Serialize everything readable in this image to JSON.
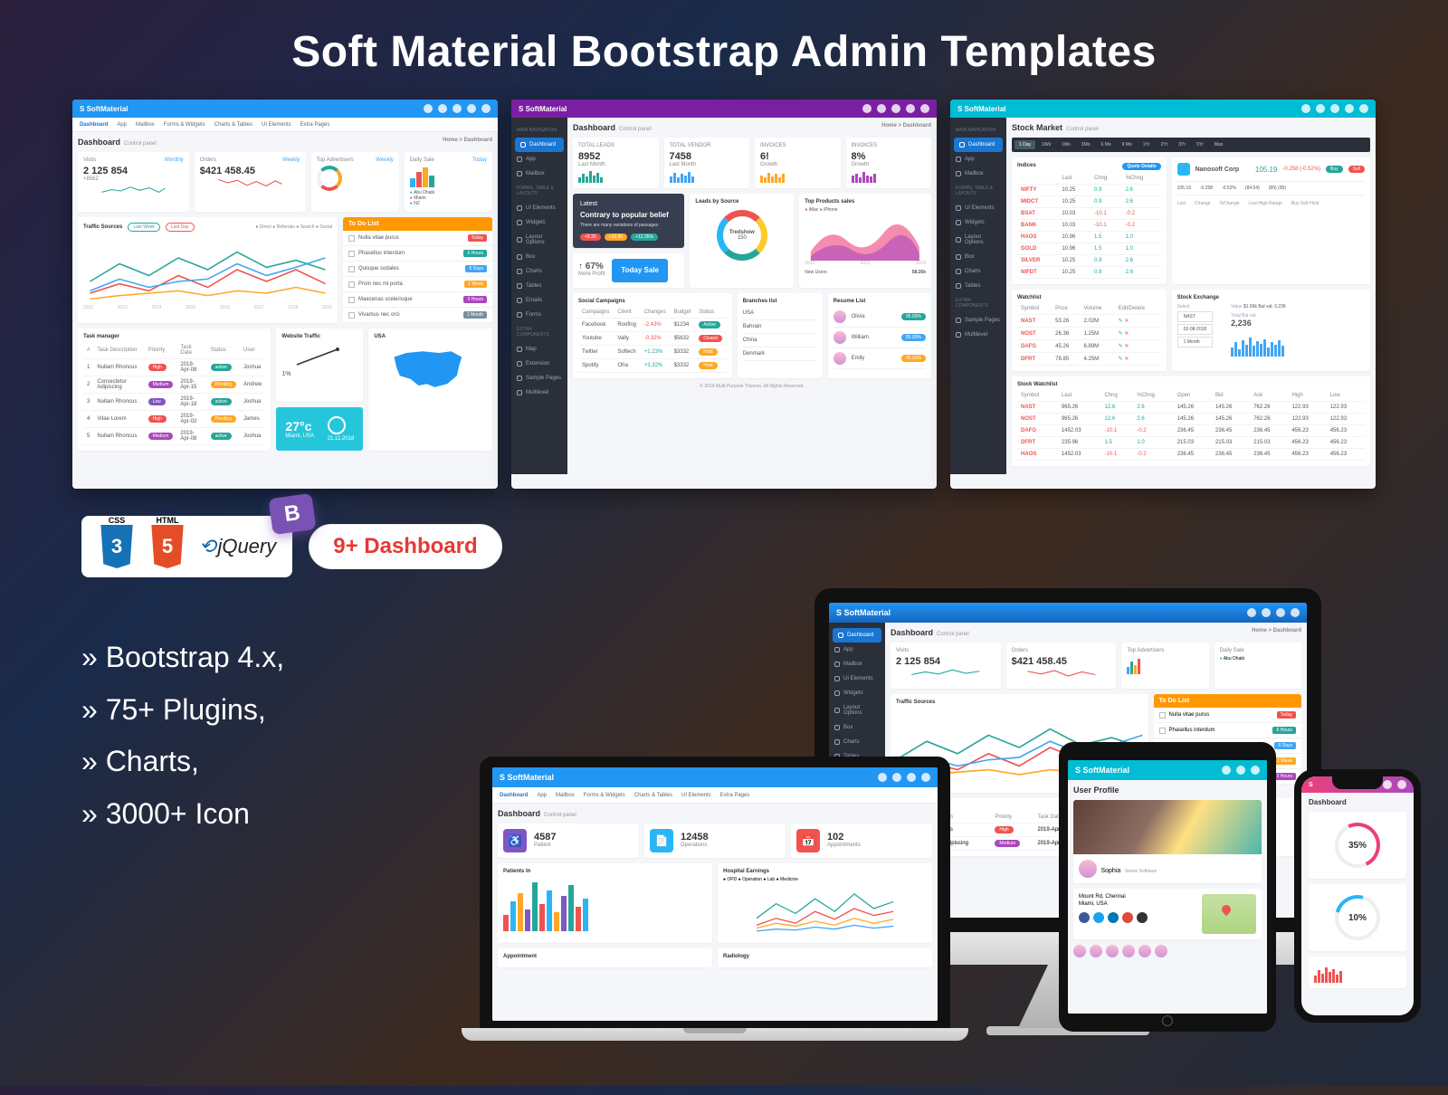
{
  "hero_title": "Soft Material Bootstrap Admin Templates",
  "brand": "SoftMaterial",
  "dash_pill": "9+ Dashboard",
  "features": [
    "Bootstrap 4.x,",
    "75+ Plugins,",
    "Charts,",
    "3000+ Icon"
  ],
  "tech": {
    "css_label": "CSS",
    "html_label": "HTML",
    "jquery": "jQuery",
    "bootstrap_b": "B"
  },
  "menubar": [
    "Dashboard",
    "App",
    "Mailbox",
    "Forms & Widgets",
    "Charts & Tables",
    "UI Elements",
    "Extra Pages"
  ],
  "breadcrumb": "Home > Dashboard",
  "page_title": "Dashboard",
  "page_subtitle": "Control panel",
  "shot1": {
    "topbar_color": "#2196f3",
    "stats": [
      {
        "label": "Visits",
        "value": "2 125 854",
        "corner": "Monthly",
        "sub": "+8562"
      },
      {
        "label": "Orders",
        "value": "$421 458.45",
        "corner": "Weekly"
      },
      {
        "label": "Top Advertisers",
        "corner": "Weekly"
      },
      {
        "label": "Daily Sale",
        "corner": "Today"
      }
    ],
    "legend_items": [
      "Abu Dhabi",
      "Miami",
      "NZ"
    ],
    "traffic": {
      "title": "Traffic Sources",
      "legend": [
        "Direct",
        "Referrals",
        "Search",
        "Social"
      ],
      "pill1": "Last Week",
      "pill2": "Last Day",
      "years": [
        "2012",
        "2013",
        "2014",
        "2015",
        "2016",
        "2017",
        "2018",
        "2019"
      ]
    },
    "todo": {
      "title": "To Do List",
      "items": [
        {
          "t": "Nulla vitae purus",
          "tag": "Today",
          "c": "#ef5350"
        },
        {
          "t": "Phasellus interdum",
          "tag": "6 Hours",
          "c": "#26a69a"
        },
        {
          "t": "Quisque sodales",
          "tag": "6 Days",
          "c": "#42a5f5"
        },
        {
          "t": "Proin nec mi porta",
          "tag": "1 Week",
          "c": "#ffa726"
        },
        {
          "t": "Maecenas scelerisque",
          "tag": "3 Hours",
          "c": "#ab47bc"
        },
        {
          "t": "Vivamus nec orci",
          "tag": "1 Month",
          "c": "#78909c"
        }
      ]
    },
    "task": {
      "title": "Task manager",
      "cols": [
        "#",
        "Task Description",
        "Priority",
        "Task Date",
        "Status",
        "User"
      ],
      "rows": [
        {
          "n": "1",
          "d": "Nullam Rhoncus",
          "p": "High",
          "pc": "#ef5350",
          "dt": "2019-Apr-08",
          "s": "active",
          "sc": "#26a69a",
          "u": "Joshua"
        },
        {
          "n": "2",
          "d": "Consectetur Adipiscing",
          "p": "Medium",
          "pc": "#ab47bc",
          "dt": "2019-Apr-15",
          "s": "Pending",
          "sc": "#ffa726",
          "u": "Andrew"
        },
        {
          "n": "3",
          "d": "Nullam Rhoncus",
          "p": "Low",
          "pc": "#7e57c2",
          "dt": "2019-Apr-18",
          "s": "active",
          "sc": "#26a69a",
          "u": "Joshua"
        },
        {
          "n": "4",
          "d": "Vitae Lorem",
          "p": "High",
          "pc": "#ef5350",
          "dt": "2019-Apr-02",
          "s": "Pending",
          "sc": "#ffa726",
          "u": "James"
        },
        {
          "n": "5",
          "d": "Nullam Rhoncus",
          "p": "Medium",
          "pc": "#ab47bc",
          "dt": "2019-Apr-08",
          "s": "active",
          "sc": "#26a69a",
          "u": "Joshua"
        }
      ]
    },
    "web_traffic": {
      "title": "Website Traffic",
      "pct": "1%"
    },
    "usa": {
      "title": "USA"
    },
    "weather": {
      "temp": "27°c",
      "city": "Miami, USA",
      "date": "21.11.2018"
    }
  },
  "shot2": {
    "topbar_color": "#7b1fa2",
    "stats": [
      {
        "label": "TOTAL LEADS",
        "value": "8952",
        "sub": "Last Month"
      },
      {
        "label": "TOTAL VENDOR",
        "value": "7458",
        "sub": "Last Month"
      },
      {
        "label": "INVOICES",
        "value": "6!",
        "sub": "Growth"
      },
      {
        "label": "INVOICES",
        "value": "8%",
        "sub": "Growth"
      }
    ],
    "latest": {
      "title": "Latest",
      "sub": "Contrary to popular belief",
      "small": "There are many variations of passages",
      "tags": [
        "+8.25",
        "+10.95",
        "+12.35%"
      ],
      "profit_pct": "67%",
      "profit_label": "More Profit",
      "sale_btn": "Today Sale"
    },
    "leads": {
      "title": "Leads by Source",
      "center": "Tredshow",
      "center_val": "150"
    },
    "top_products": {
      "title": "Top Products sales",
      "legend": [
        "iMac",
        "iPhone"
      ],
      "years": [
        "2012",
        "2013",
        "2014",
        "2015",
        "2016",
        "2017",
        "2018",
        "2019"
      ],
      "new_users": "New Users",
      "new_users_val": "58.26k"
    },
    "social": {
      "title": "Social Campaigns",
      "cols": [
        "Campaigns",
        "Client",
        "Changes",
        "Budget",
        "Status"
      ],
      "rows": [
        {
          "c": "Facebook",
          "cl": "Roofing",
          "ch": "-2.43%",
          "chc": "#ef5350",
          "b": "$1234",
          "s": "Active",
          "sc": "#26a69a"
        },
        {
          "c": "Youtube",
          "cl": "Vally",
          "ch": "-0.32%",
          "chc": "#ef5350",
          "b": "$5632",
          "s": "Closed",
          "sc": "#ef5350"
        },
        {
          "c": "Twitter",
          "cl": "Softech",
          "ch": "+1.23%",
          "chc": "#26a69a",
          "b": "$3332",
          "s": "Hold",
          "sc": "#ffa726"
        },
        {
          "c": "Spotify",
          "cl": "Ofra",
          "ch": "+3.32%",
          "chc": "#26a69a",
          "b": "$3332",
          "s": "Hold",
          "sc": "#ffa726"
        }
      ]
    },
    "branches": {
      "title": "Branches list",
      "items": [
        "USA",
        "Bahrain",
        "China",
        "Denmark"
      ]
    },
    "resume": {
      "title": "Resume List",
      "items": [
        {
          "n": "Olivia",
          "s": "95.00%",
          "sc": "#26a69a"
        },
        {
          "n": "William",
          "s": "85.00%",
          "sc": "#42a5f5"
        },
        {
          "n": "Emily",
          "s": "45.00%",
          "sc": "#ffa726"
        }
      ]
    },
    "footer": "© 2019 Multi-Purpose Themes. All Rights Reserved."
  },
  "shot3": {
    "topbar_color": "#00bcd4",
    "page_title": "Stock Market",
    "tabs": [
      "1 Day",
      "1Wk",
      "1Mo",
      "3Mo",
      "6 Mo",
      "9 Mo",
      "1Yr",
      "2Yr",
      "3Yr",
      "5Yr",
      "Max"
    ],
    "indices": {
      "title": "Indices",
      "btn": "Quote Details",
      "cols": [
        "",
        "Last",
        "Chng",
        "%Chng"
      ],
      "rows": [
        {
          "s": "NIFTY",
          "l": "10.25",
          "c": "0.9",
          "p": "2.6"
        },
        {
          "s": "MIDCT",
          "l": "10.25",
          "c": "0.9",
          "p": "2.6"
        },
        {
          "s": "BSAT",
          "l": "10.03",
          "c": "-10.1",
          "p": "-0.2"
        },
        {
          "s": "BANK",
          "l": "10.03",
          "c": "-10.1",
          "p": "-0.2"
        },
        {
          "s": "HAOS",
          "l": "10.96",
          "c": "1.5",
          "p": "1.0"
        },
        {
          "s": "GOLD",
          "l": "10.96",
          "c": "1.5",
          "p": "1.0"
        },
        {
          "s": "SILVER",
          "l": "10.25",
          "c": "0.9",
          "p": "2.6"
        },
        {
          "s": "NIFDT",
          "l": "10.25",
          "c": "0.9",
          "p": "2.6"
        }
      ],
      "ticker": {
        "name": "Nanosoft Corp",
        "v": "105.19",
        "c": "-0.258 (-0.52%)",
        "buy": "Buy",
        "sell": "Sell",
        "row": [
          "105.19",
          "-0.258",
          "-0.52%",
          "(84.54)",
          "(89) (95)"
        ],
        "row_labels": [
          "Last",
          "Change",
          "%Change",
          "Low-High Range",
          "Buy-Sell-Hold"
        ]
      }
    },
    "watchlist": {
      "title": "Watchlist",
      "cols": [
        "Symbol",
        "Price",
        "Volume",
        "Edit/Delete"
      ],
      "rows": [
        {
          "s": "NAST",
          "p": "53.26",
          "v": "2.02M"
        },
        {
          "s": "NOST",
          "p": "26.36",
          "v": "1.25M"
        },
        {
          "s": "DAFG",
          "p": "45.26",
          "v": "6.89M"
        },
        {
          "s": "DFRT",
          "p": "78.85",
          "v": "4.25M"
        }
      ]
    },
    "exchange": {
      "title": "Stock Exchange",
      "sel_label": "Select",
      "sel_val": "02-08-2018",
      "val_label": "Value",
      "val": "$1.56k Bal val: 3.236",
      "total_label": "Total Bal val:",
      "total": "2,236",
      "sel2": "NAST",
      "sel3": "1 Month"
    },
    "stock_watchlist": {
      "title": "Stock Watchlist",
      "cols": [
        "Symbol",
        "Last",
        "Chng",
        "%Chng",
        "Open",
        "Bid",
        "Ask",
        "High",
        "Low"
      ],
      "rows": [
        {
          "s": "NAST",
          "l": "965.26",
          "c": "12.6",
          "p": "2.6",
          "o": "145.26",
          "b": "145.26",
          "a": "762.26",
          "h": "122.93",
          "lo": "122.93"
        },
        {
          "s": "NOST",
          "l": "965.26",
          "c": "12.6",
          "p": "2.6",
          "o": "145.26",
          "b": "145.26",
          "a": "762.26",
          "h": "122.93",
          "lo": "122.93"
        },
        {
          "s": "DAFG",
          "l": "1452.03",
          "c": "-10.1",
          "p": "-0.2",
          "o": "236.45",
          "b": "236.45",
          "a": "236.45",
          "h": "456.23",
          "lo": "456.23"
        },
        {
          "s": "DFRT",
          "l": "235.96",
          "c": "1.5",
          "p": "1.0",
          "o": "215.03",
          "b": "215.03",
          "a": "215.03",
          "h": "456.23",
          "lo": "456.23"
        },
        {
          "s": "HAOS",
          "l": "1452.03",
          "c": "-10.1",
          "p": "-0.2",
          "o": "236.45",
          "b": "236.45",
          "a": "236.45",
          "h": "456.23",
          "lo": "456.23"
        }
      ]
    }
  },
  "sidebar_items": [
    "Dashboard",
    "App",
    "Mailbox",
    "UI Elements",
    "Widgets",
    "Layout Options",
    "Box",
    "Charts",
    "Tables",
    "Emails",
    "Forms",
    "Map",
    "Extension",
    "Sample Pages",
    "Multilevel"
  ],
  "sidebar_header": "MAIN NAVIGATION",
  "sidebar_header2": "FORMS, TABLE & LAYOUTS",
  "sidebar_header3": "EXTRA COMPONENTS",
  "macbook": {
    "stats": [
      {
        "icon_bg": "#7e57c2",
        "val": "4587",
        "lbl": "Patient"
      },
      {
        "icon_bg": "#29b6f6",
        "val": "12458",
        "lbl": "Operations"
      },
      {
        "icon_bg": "#ef5350",
        "val": "102",
        "lbl": "Appointments"
      }
    ],
    "patients_title": "Patients In",
    "hosp_title": "Hospital Earnings",
    "hosp_legend": [
      "OPD",
      "Operation",
      "Lab",
      "Medicine"
    ],
    "appointment": "Appointment",
    "radiology": "Radiology"
  },
  "ipad": {
    "title": "User Profile",
    "name": "Sophia",
    "role": "Senior Software",
    "loc": "Mount Rd, Chennai",
    "loc2": "Miami, USA"
  },
  "iphone": {
    "gauge1": "35%",
    "gauge2": "10%"
  }
}
